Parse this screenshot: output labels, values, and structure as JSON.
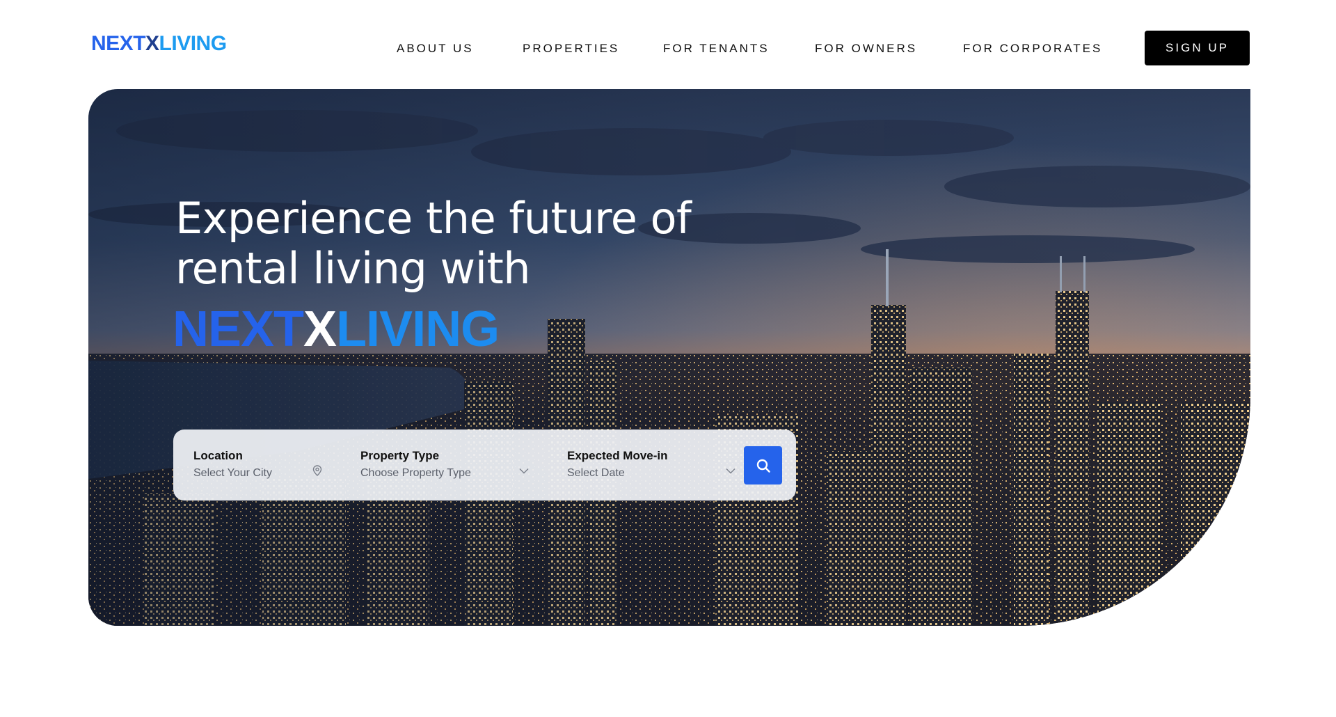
{
  "brand": {
    "logo_parts": {
      "n": "N",
      "next": "EXT",
      "x": "X",
      "living": "LIVING"
    },
    "colors": {
      "primary_blue": "#2563eb",
      "light_blue": "#1d9bf0",
      "black": "#000000",
      "white": "#ffffff"
    }
  },
  "nav": {
    "items": [
      {
        "label": "ABOUT US"
      },
      {
        "label": "PROPERTIES"
      },
      {
        "label": "FOR TENANTS"
      },
      {
        "label": "FOR OWNERS"
      },
      {
        "label": "FOR CORPORATES"
      }
    ],
    "signup_label": "SIGN UP"
  },
  "hero": {
    "heading_line1": "Experience the future of",
    "heading_line2": "rental living with",
    "brand_parts": {
      "n": "N",
      "next": "EXT",
      "x": "X",
      "living": "LIVING"
    },
    "background": "night-city-skyline-image"
  },
  "search": {
    "location": {
      "label": "Location",
      "placeholder": "Select Your City",
      "icon": "location-pin-icon"
    },
    "property_type": {
      "label": "Property Type",
      "placeholder": "Choose Property Type",
      "icon": "chevron-down-icon"
    },
    "move_in": {
      "label": "Expected Move-in",
      "placeholder": "Select Date",
      "icon": "chevron-down-icon"
    },
    "button_icon": "search-icon"
  }
}
